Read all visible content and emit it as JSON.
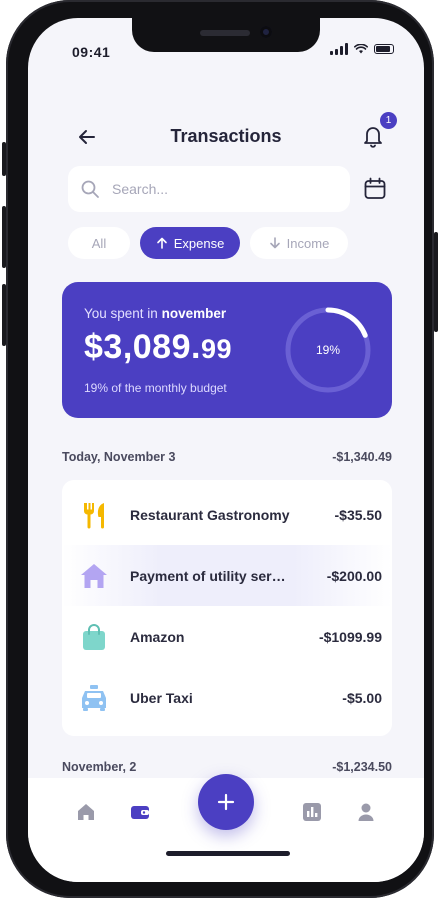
{
  "status": {
    "time": "09:41"
  },
  "header": {
    "title": "Transactions",
    "badge": "1"
  },
  "search": {
    "placeholder": "Search..."
  },
  "filters": [
    {
      "label": "All"
    },
    {
      "label": "Expense"
    },
    {
      "label": "Income"
    }
  ],
  "summary": {
    "prefix": "You spent in ",
    "month": "november",
    "amount_main": "$3,089.",
    "amount_cents": "99",
    "budget_text": "19% of the monthly budget",
    "ring_label": "19%",
    "ring_fraction": 0.19
  },
  "groups": [
    {
      "date": "Today, November 3",
      "total": "-$1,340.49"
    },
    {
      "date": "November, 2",
      "total": "-$1,234.50"
    }
  ],
  "transactions": [
    {
      "name": "Restaurant Gastronomy",
      "amount": "-$35.50",
      "icon": "fork-knife-icon"
    },
    {
      "name": "Payment of utility services",
      "amount": "-$200.00",
      "icon": "house-icon"
    },
    {
      "name": "Amazon",
      "amount": "-$1099.99",
      "icon": "shopping-bag-icon"
    },
    {
      "name": "Uber Taxi",
      "amount": "-$5.00",
      "icon": "taxi-icon"
    }
  ],
  "colors": {
    "accent": "#4b3fc2",
    "background": "#f5f5fa",
    "food": "#f5b800",
    "house": "#b3a5f2",
    "bag": "#7ed6cb",
    "taxi": "#8fc2f2"
  }
}
